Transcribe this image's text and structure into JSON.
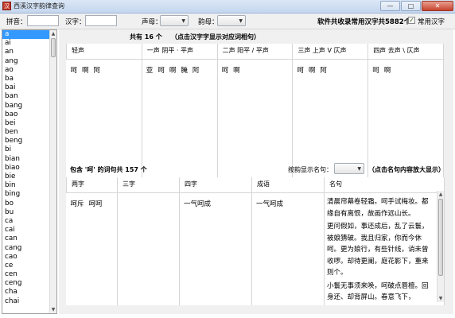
{
  "window": {
    "title": "西溪汉字韵律查询",
    "minimize": "—",
    "maximize": "□",
    "close": "✕",
    "icon_char": "汉"
  },
  "toolbar": {
    "pinyin_label": "拼音：",
    "pinyin_value": "",
    "hanzi_label": "汉字：",
    "hanzi_value": "",
    "shengmu_label": "声母：",
    "shengmu_value": "",
    "yunmu_label": "韵母：",
    "yunmu_value": "",
    "summary_prefix": "软件共收录常用汉字共",
    "summary_count": "5882",
    "summary_suffix": "个",
    "common_label": "常用汉字",
    "common_checked": true
  },
  "pinyin_list": {
    "selected": "a",
    "items": [
      "a",
      "ai",
      "an",
      "ang",
      "ao",
      "ba",
      "bai",
      "ban",
      "bang",
      "bao",
      "bei",
      "ben",
      "beng",
      "bi",
      "bian",
      "biao",
      "bie",
      "bin",
      "bing",
      "bo",
      "bu",
      "ca",
      "cai",
      "can",
      "cang",
      "cao",
      "ce",
      "cen",
      "ceng",
      "cha",
      "chai"
    ]
  },
  "tones": {
    "count_text": "共有 16 个",
    "hint": "（点击汉字字显示对应词相句）",
    "columns": [
      {
        "header": "轻声",
        "chars": [
          "呵",
          "啊",
          "阿"
        ]
      },
      {
        "header": "一声 阴平 · 平声",
        "chars": [
          "亚",
          "呵",
          "啊",
          "腌",
          "阿"
        ]
      },
      {
        "header": "二声 阳平 / 平声",
        "chars": [
          "呵",
          "啊"
        ]
      },
      {
        "header": "三声 上声 V 仄声",
        "chars": [
          "呵",
          "啊",
          "阿"
        ]
      },
      {
        "header": "四声 去声 \\ 仄声",
        "chars": [
          "呵",
          "啊"
        ]
      }
    ]
  },
  "words": {
    "count_text": "包含 '呵' 的词句共 157 个",
    "display_label": "按韵显示名句：",
    "display_value": "",
    "hint": "（点击名句内容放大显示）",
    "columns": {
      "two": {
        "header": "两字",
        "items": [
          "呵斥",
          "呵呵"
        ]
      },
      "three": {
        "header": "三字",
        "items": []
      },
      "four": {
        "header": "四字",
        "items": [
          "一气呵成"
        ]
      },
      "idiom": {
        "header": "成语",
        "items": [
          "一气呵成"
        ]
      },
      "quotes": {
        "header": "名句",
        "items": [
          "清晨帘幕卷轻霜。呵手试梅妆。都缘自有离恨，故画作远山长。",
          "更问假如，事还成后，乱了云鬟，被娘猜破。我且归家，你而今休呵。更为娘行，有些针线，诮未曾收啰。却待更阑，庭花影下，重来则个。",
          "小鬟无事须来唤，呵破点唇檀。回身还、却背屏山。春意飞下，"
        ]
      }
    }
  }
}
